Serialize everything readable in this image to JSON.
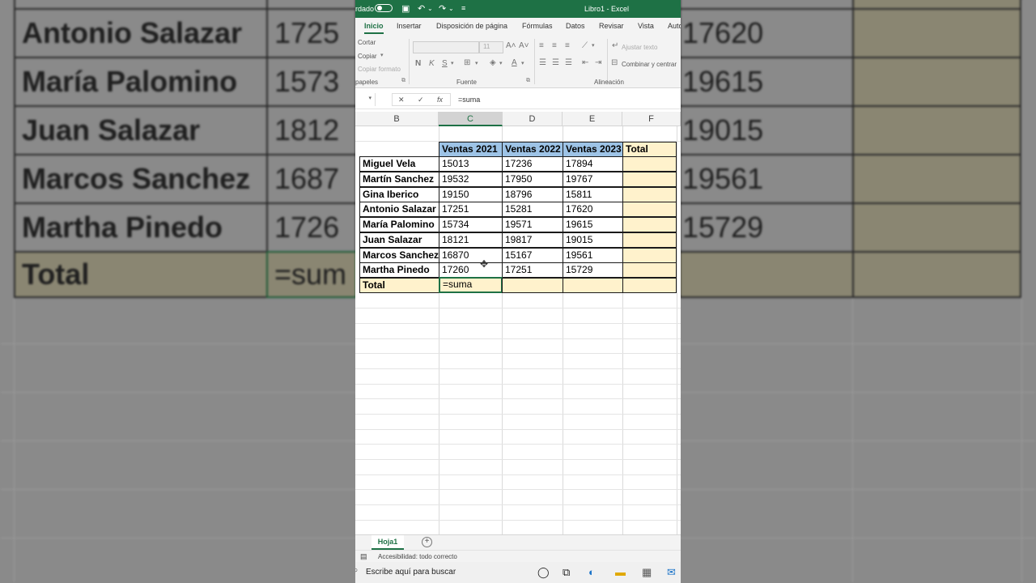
{
  "title_bar": {
    "autosave_label": "rdado",
    "title": "Libro1 - Excel"
  },
  "tabs": [
    "Inicio",
    "Insertar",
    "Disposición de página",
    "Fórmulas",
    "Datos",
    "Revisar",
    "Vista",
    "Autom"
  ],
  "ribbon": {
    "cut": "Cortar",
    "copy": "Copiar",
    "format_painter": "Copiar formato",
    "clipboard_group": "papeles",
    "font_group": "Fuente",
    "font_size": "11",
    "bold": "N",
    "italic": "K",
    "underline": "S",
    "wrap_text": "Ajustar texto",
    "merge_center": "Combinar y centrar",
    "alignment_group": "Alineación"
  },
  "formula_bar": {
    "cancel": "✕",
    "enter": "✓",
    "fx": "fx",
    "content": "=suma"
  },
  "columns": [
    "B",
    "C",
    "D",
    "E",
    "F"
  ],
  "table": {
    "headers": [
      "Ventas 2021",
      "Ventas 2022",
      "Ventas 2023",
      "Total"
    ],
    "rows": [
      {
        "name": "Miguel Vela",
        "v2021": "15013",
        "v2022": "17236",
        "v2023": "17894"
      },
      {
        "name": "Martín Sanchez",
        "v2021": "19532",
        "v2022": "17950",
        "v2023": "19767"
      },
      {
        "name": "Gina Iberico",
        "v2021": "19150",
        "v2022": "18796",
        "v2023": "15811"
      },
      {
        "name": "Antonio Salazar",
        "v2021": "17251",
        "v2022": "15281",
        "v2023": "17620"
      },
      {
        "name": "María Palomino",
        "v2021": "15734",
        "v2022": "19571",
        "v2023": "19615"
      },
      {
        "name": "Juan Salazar",
        "v2021": "18121",
        "v2022": "19817",
        "v2023": "19015"
      },
      {
        "name": "Marcos Sanchez",
        "v2021": "16870",
        "v2022": "15167",
        "v2023": "19561"
      },
      {
        "name": "Martha Pinedo",
        "v2021": "17260",
        "v2022": "17251",
        "v2023": "15729"
      }
    ],
    "total_label": "Total",
    "total_c_formula": "=suma"
  },
  "background": {
    "rows": [
      {
        "name": "Antonio Salazar",
        "v2021": "1725",
        "v2023": "17620"
      },
      {
        "name": "María Palomino",
        "v2021": "1573",
        "v2023": "19615"
      },
      {
        "name": "Juan Salazar",
        "v2021": "1812",
        "v2023": "19015"
      },
      {
        "name": "Marcos Sanchez",
        "v2021": "1687",
        "v2023": "19561"
      },
      {
        "name": "Martha Pinedo",
        "v2021": "1726",
        "v2023": "15729"
      }
    ],
    "total_label": "Total",
    "total_formula": "=sum"
  },
  "sheet_tab": "Hoja1",
  "add_sheet": "+",
  "status": {
    "accessibility": "Accesibilidad: todo correcto"
  },
  "taskbar": {
    "search_placeholder": "Escribe aquí para buscar"
  },
  "colors": {
    "excel_green": "#1e7145",
    "header_blue": "#9dc3e6",
    "total_yellow": "#fff2cc"
  }
}
